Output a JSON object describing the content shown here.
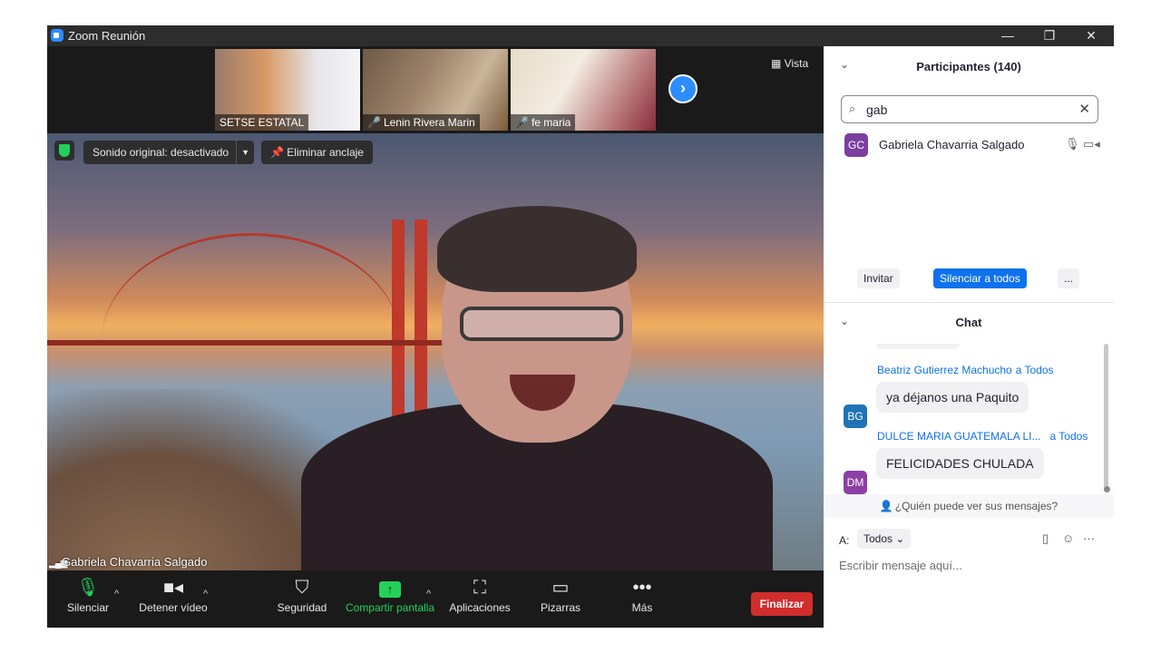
{
  "window": {
    "title": "Zoom Reunión",
    "minimize": "—",
    "restore": "❐",
    "close": "✕"
  },
  "thumbnails": [
    {
      "name": "SETSE ESTATAL",
      "muted": false
    },
    {
      "name": "Lenin Rivera Marin",
      "muted": true
    },
    {
      "name": "fe maria",
      "muted": true
    }
  ],
  "view_button": "Vista",
  "main_video": {
    "original_sound": "Sonido original: desactivado",
    "unpin": "Eliminar anclaje",
    "speaker_name": "Gabriela Chavarria Salgado"
  },
  "toolbar": {
    "mute": "Silenciar",
    "stop_video": "Detener vídeo",
    "security": "Seguridad",
    "share_screen": "Compartir pantalla",
    "apps": "Aplicaciones",
    "whiteboards": "Pizarras",
    "more": "Más",
    "end": "Finalizar"
  },
  "participants": {
    "title": "Participantes (140)",
    "search_value": "gab",
    "list": [
      {
        "initials": "GC",
        "name": "Gabriela Chavarria Salgado",
        "avatar_color": "#7b3fa0"
      }
    ],
    "invite": "Invitar",
    "mute_all": "Silenciar a todos",
    "more": "..."
  },
  "chat": {
    "title": "Chat",
    "messages": [
      {
        "initials": "BG",
        "sender": "Beatriz Gutierrez Machucho",
        "to": "a Todos",
        "text": "ya déjanos una Paquito",
        "avatar_color": "#1f73b7"
      },
      {
        "initials": "DM",
        "sender": "DULCE MARIA GUATEMALA LI...",
        "to": "a Todos",
        "text": "FELICIDADES CHULADA",
        "avatar_color": "#8e3fa3"
      }
    ],
    "who_can_see": "¿Quién puede ver sus mensajes?",
    "to_label": "A:",
    "to_value": "Todos",
    "placeholder": "Escribir mensaje aquí..."
  },
  "colors": {
    "accent": "#0e72ed",
    "end_button": "#d12d2d",
    "share_green": "#23d05a"
  }
}
